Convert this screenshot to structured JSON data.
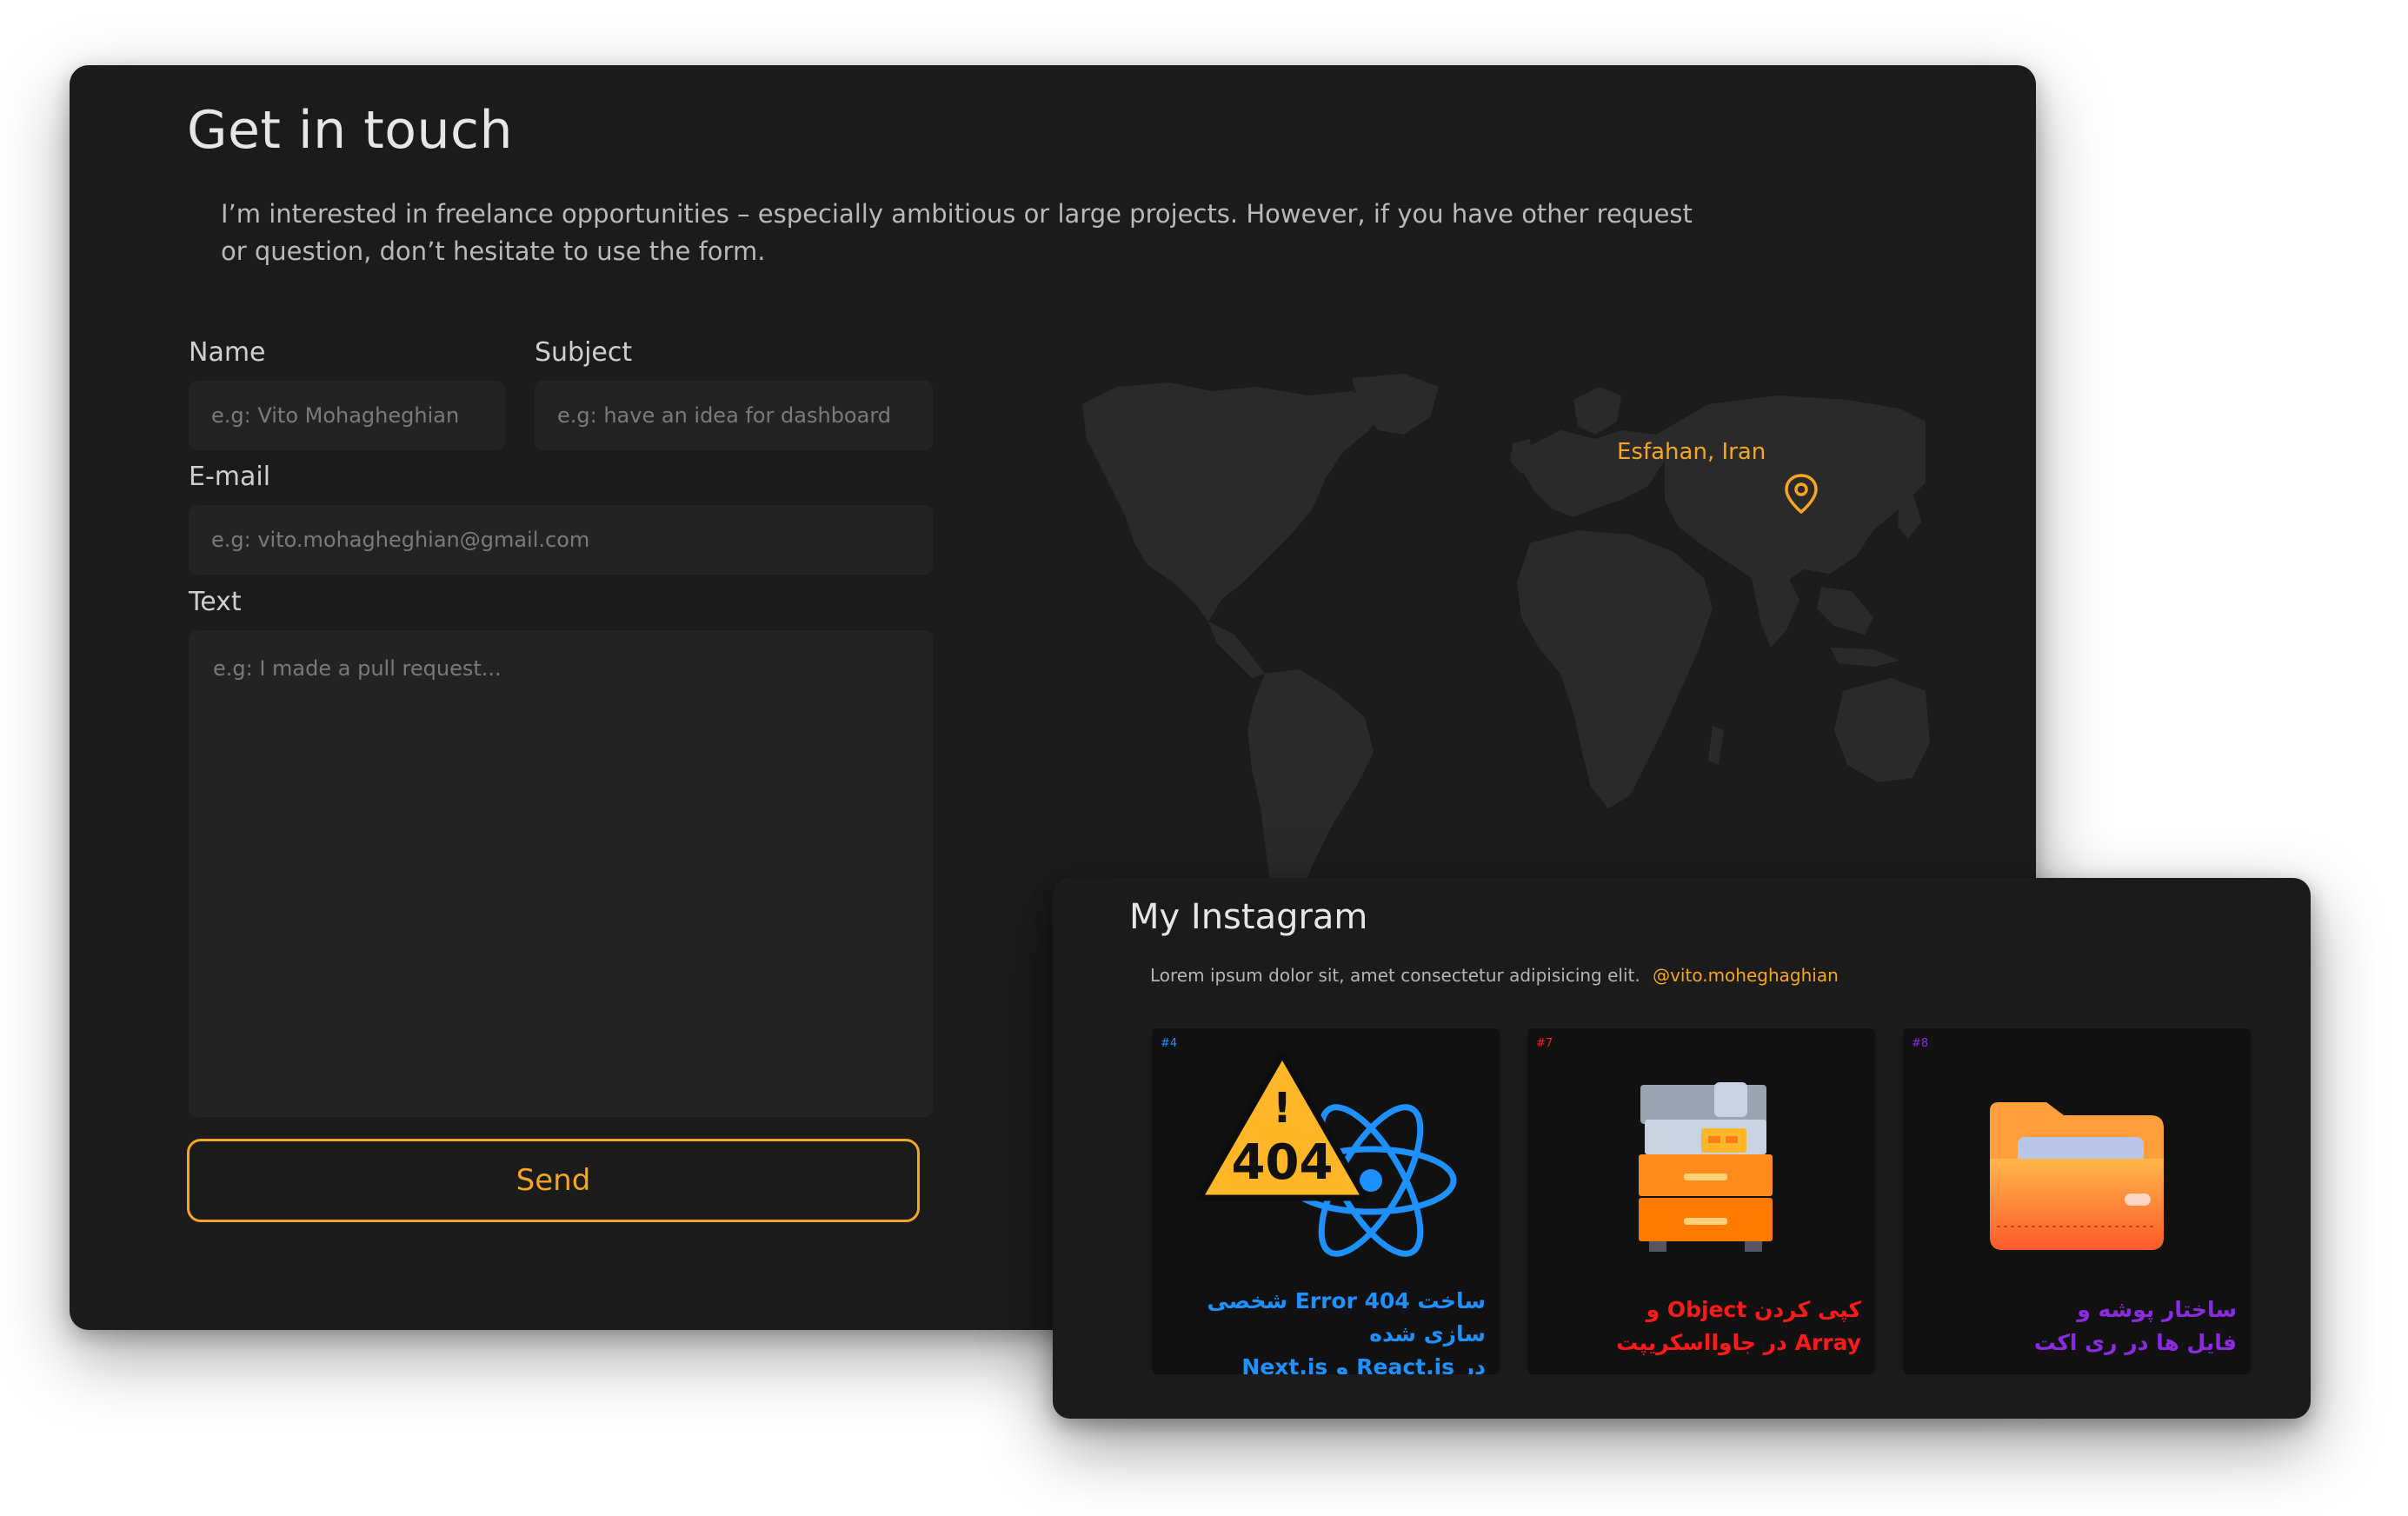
{
  "contact": {
    "title": "Get in touch",
    "intro": "I’m interested in freelance opportunities – especially ambitious or large projects. However, if you have other request or question, don’t hesitate to use the form.",
    "fields": {
      "name": {
        "label": "Name",
        "placeholder": "e.g: Vito Mohagheghian"
      },
      "subject": {
        "label": "Subject",
        "placeholder": "e.g: have an idea for dashboard"
      },
      "email": {
        "label": "E-mail",
        "placeholder": "e.g: vito.mohagheghian@gmail.com"
      },
      "text": {
        "label": "Text",
        "placeholder": "e.g: I made a pull request..."
      }
    },
    "send_label": "Send",
    "accent_color": "#f5a623"
  },
  "map": {
    "location_label": "Esfahan, Iran",
    "pin_icon": "location-pin-icon"
  },
  "instagram": {
    "title": "My Instagram",
    "description": "Lorem ipsum dolor sit, amet consectetur adipisicing elit.",
    "handle": "@vito.moheghaghian",
    "posts": [
      {
        "number": "#4",
        "accent": "#1e90ff",
        "icon": "warning-404-react-icon",
        "caption_line1": "ساخت Error 404 شخصی سازی شده",
        "caption_line2": "در React.js و Next.js"
      },
      {
        "number": "#7",
        "accent": "#ff1a1a",
        "icon": "copier-machine-icon",
        "caption_line1": "کپی کردن Object و",
        "caption_line2": "Array در جاوااسکریپت"
      },
      {
        "number": "#8",
        "accent": "#8a2be2",
        "icon": "folder-icon",
        "caption_line1": "ساختار پوشه و",
        "caption_line2": "فایل ها در ری اکت"
      }
    ]
  }
}
